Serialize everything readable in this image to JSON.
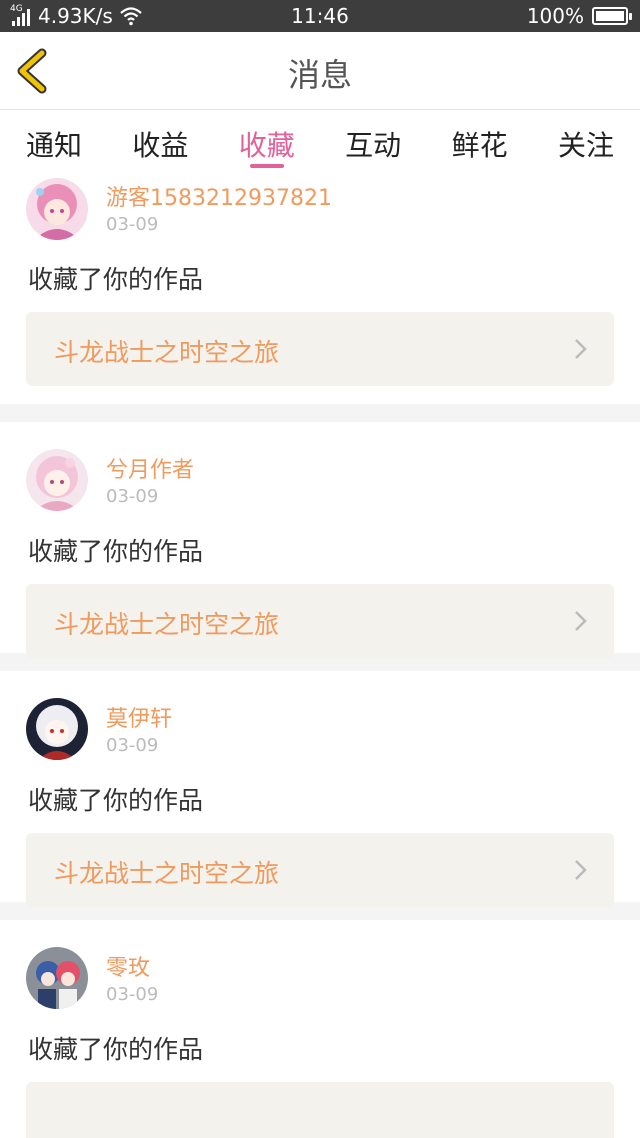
{
  "status_bar": {
    "network_type": "4G",
    "speed": "4.93K/s",
    "time": "11:46",
    "battery": "100%"
  },
  "header": {
    "back_icon": "chevron-left-icon",
    "title": "消息",
    "accent_color": "#f2c300"
  },
  "tabs": [
    {
      "label": "通知",
      "active": false
    },
    {
      "label": "收益",
      "active": false
    },
    {
      "label": "收藏",
      "active": true
    },
    {
      "label": "互动",
      "active": false
    },
    {
      "label": "鲜花",
      "active": false
    },
    {
      "label": "关注",
      "active": false
    }
  ],
  "active_color": "#e3619a",
  "messages": [
    {
      "user": "游客1583212937821",
      "date": "03-09",
      "action": "收藏了你的作品",
      "work": "斗龙战士之时空之旅",
      "avatar_icon": "anime-girl-avatar"
    },
    {
      "user": "兮月作者",
      "date": "03-09",
      "action": "收藏了你的作品",
      "work": "斗龙战士之时空之旅",
      "avatar_icon": "anime-girl-avatar"
    },
    {
      "user": "莫伊轩",
      "date": "03-09",
      "action": "收藏了你的作品",
      "work": "斗龙战士之时空之旅",
      "avatar_icon": "anime-girl-avatar"
    },
    {
      "user": "零玫",
      "date": "03-09",
      "action": "收藏了你的作品",
      "work": "",
      "avatar_icon": "anime-duo-avatar"
    }
  ]
}
